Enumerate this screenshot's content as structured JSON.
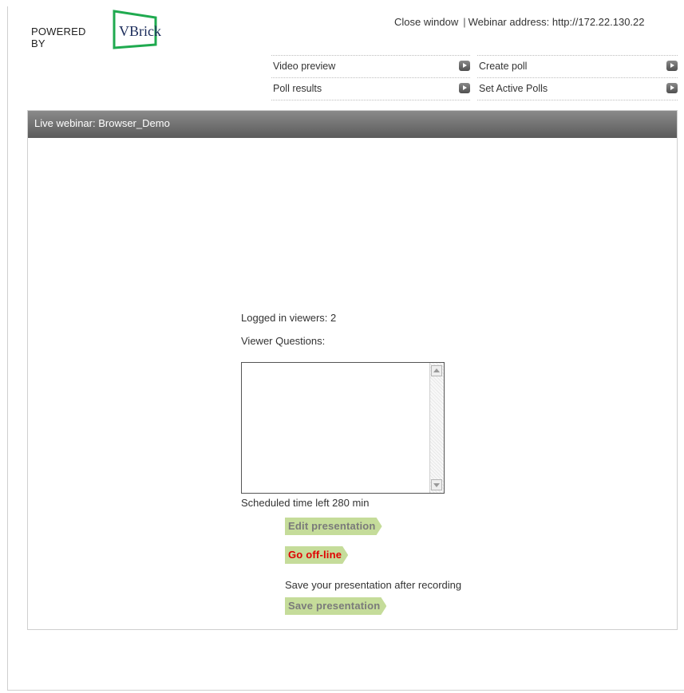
{
  "logo": {
    "powered_by": "POWERED BY",
    "brand": "VBrick",
    "mark_color": "#1faa4f"
  },
  "header": {
    "close_window": "Close window",
    "separator": "|",
    "webinar_address": "Webinar address: http://172.22.130.22"
  },
  "menu": {
    "video_preview": "Video preview",
    "create_poll": "Create poll",
    "poll_results": "Poll results",
    "set_active_polls": "Set Active Polls"
  },
  "panel": {
    "title": "Live webinar: Browser_Demo",
    "logged_in_viewers": "Logged in viewers: 2",
    "viewer_questions_label": "Viewer Questions:",
    "viewer_questions_value": "",
    "scheduled_time_left": "Scheduled time left 280 min",
    "edit_presentation": "Edit presentation",
    "go_offline": "Go off-line",
    "save_hint": "Save your presentation after recording",
    "save_presentation": "Save presentation"
  },
  "colors": {
    "header_bar": "#6e6e6e",
    "button_green": "#c5dc9a",
    "alert_red": "#e00000"
  }
}
